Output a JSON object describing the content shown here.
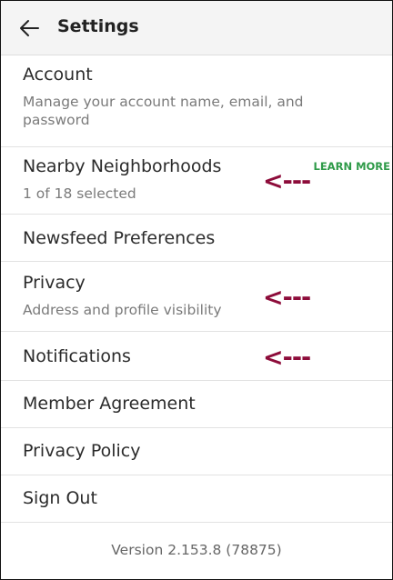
{
  "header": {
    "title": "Settings",
    "back_icon": "arrow-left-icon"
  },
  "items": [
    {
      "label": "Account",
      "subtitle": "Manage your account name, email, and password"
    },
    {
      "label": "Nearby Neighborhoods",
      "subtitle": "1 of 18 selected",
      "action": "LEARN MORE"
    },
    {
      "label": "Newsfeed Preferences"
    },
    {
      "label": "Privacy",
      "subtitle": "Address and profile visibility"
    },
    {
      "label": "Notifications"
    },
    {
      "label": "Member Agreement"
    },
    {
      "label": "Privacy Policy"
    },
    {
      "label": "Sign Out"
    }
  ],
  "annotations": {
    "arrow": "<---",
    "color": "#8d0c3a"
  },
  "footer": {
    "version": "Version 2.153.8 (78875)"
  },
  "colors": {
    "accent_green": "#2e9a48",
    "header_bg": "#f4f4f4"
  }
}
